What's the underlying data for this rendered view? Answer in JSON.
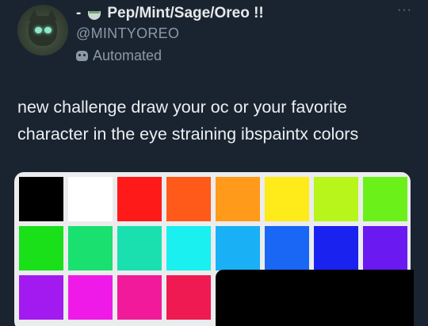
{
  "tweet": {
    "display_name": "Pep/Mint/Sage/Oreo !!",
    "name_prefix": "-",
    "name_emoji": "teacup-icon",
    "handle": "@MINTYOREO",
    "automated_label": "Automated",
    "more_label": "···",
    "text": "new challenge draw your oc or your favorite character in the eye straining ibspaintx colors"
  },
  "palette": {
    "rows": [
      [
        "#000000",
        "#ffffff",
        "#ff1a1a",
        "#ff5a1a",
        "#ff9a1a",
        "#ffea1a",
        "#b8f51a",
        "#6cf01a"
      ],
      [
        "#1ae01a",
        "#1ae070",
        "#1ae0b0",
        "#1af0f0",
        "#1ab0f5",
        "#1a66f5",
        "#1a22f0",
        "#6a1af0"
      ],
      [
        "#a21af0",
        "#f01ae8",
        "#f01a9a",
        "#f01a52"
      ]
    ]
  },
  "colors": {
    "background": "#1a2431",
    "text_primary": "#e7e9ea",
    "text_secondary": "#8b98a5"
  }
}
